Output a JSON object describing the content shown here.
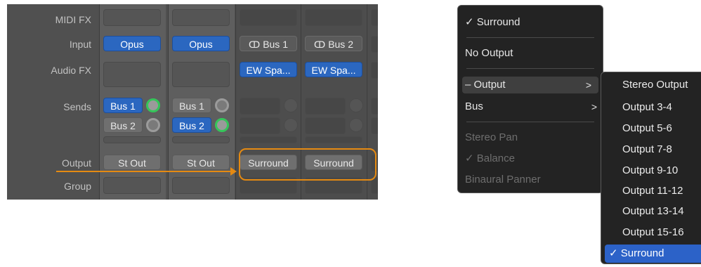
{
  "mixer": {
    "rows": {
      "midi_fx": "MIDI FX",
      "input": "Input",
      "audio_fx": "Audio FX",
      "sends": "Sends",
      "output": "Output",
      "group": "Group"
    },
    "strips": [
      {
        "input": "Opus",
        "send1": "Bus 1",
        "send2": "Bus 2",
        "output": "St Out"
      },
      {
        "input": "Opus",
        "send1": "Bus 1",
        "send2": "Bus 2",
        "output": "St Out"
      },
      {
        "input": "Bus 1",
        "audio_fx": "EW Spa...",
        "output": "Surround"
      },
      {
        "input": "Bus 2",
        "audio_fx": "EW Spa...",
        "output": "Surround"
      }
    ],
    "link_glyph": "ↀ",
    "accent_color": "#e58a12"
  },
  "menu": {
    "items": {
      "surround": "Surround",
      "no_output": "No Output",
      "output": "Output",
      "bus": "Bus",
      "stereo_pan": "Stereo Pan",
      "balance": "Balance",
      "binaural": "Binaural Panner"
    },
    "check": "✓",
    "dash": "–",
    "chevron": ">"
  },
  "submenu": {
    "items": [
      "Stereo Output",
      "Output 3-4",
      "Output 5-6",
      "Output 7-8",
      "Output 9-10",
      "Output 11-12",
      "Output 13-14",
      "Output 15-16"
    ],
    "selected": "Surround",
    "selected_color": "#2c62c8"
  }
}
